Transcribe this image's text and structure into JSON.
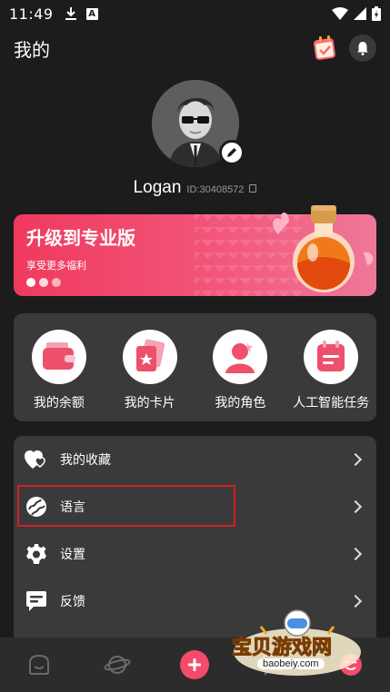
{
  "status_bar": {
    "time": "11:49"
  },
  "header": {
    "title": "我的"
  },
  "profile": {
    "name": "Logan",
    "user_id": "ID:30408572"
  },
  "pro_banner": {
    "title": "升级到专业版",
    "subtitle": "享受更多福利"
  },
  "quick_actions": [
    {
      "label": "我的余额",
      "icon": "wallet-icon"
    },
    {
      "label": "我的卡片",
      "icon": "cards-icon"
    },
    {
      "label": "我的角色",
      "icon": "character-icon"
    },
    {
      "label": "人工智能任务",
      "icon": "calendar-task-icon"
    }
  ],
  "menu": [
    {
      "label": "我的收藏",
      "icon": "hearts-icon"
    },
    {
      "label": "语言",
      "icon": "globe-icon"
    },
    {
      "label": "设置",
      "icon": "gear-icon"
    },
    {
      "label": "反馈",
      "icon": "feedback-icon"
    }
  ],
  "watermark": {
    "text": "宝贝游戏网",
    "url": "baobeiy.com"
  },
  "colors": {
    "accent": "#f24b6c",
    "background": "#1c1c1c",
    "card": "#3a3a3a",
    "highlight": "#d31f28"
  }
}
